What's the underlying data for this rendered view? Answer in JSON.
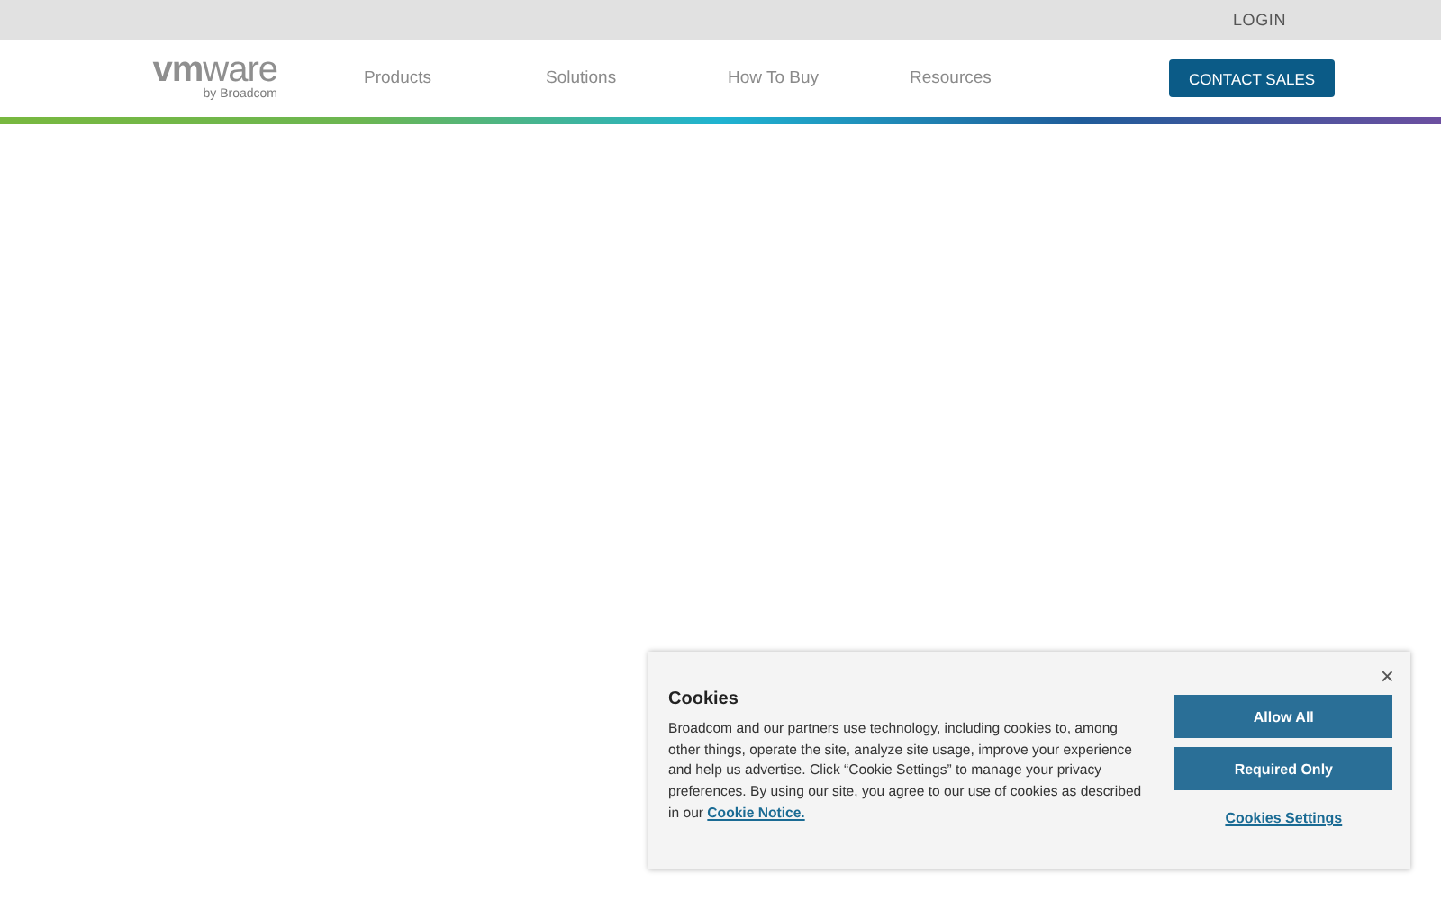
{
  "utility_bar": {
    "login": "LOGIN"
  },
  "header": {
    "logo": "**vm**ware",
    "logo_sub": "by Broadcom",
    "nav": [
      "Products",
      "Solutions",
      "How To Buy",
      "Resources"
    ],
    "cta": "CONTACT SALES"
  },
  "cookie_banner": {
    "close": "×",
    "title": "Cookies",
    "text": "Broadcom and our partners use technology, including cookies to, among other things, operate the site, analyze site usage, improve your experience and help us advertise. Click “Cookie Settings” to manage your privacy preferences. By using our site, you agree to our use of cookies as described in our",
    "link": "Cookie Notice.",
    "buttons": [
      "Allow All",
      "Required Only"
    ],
    "settings_link": "Cookies Settings"
  }
}
